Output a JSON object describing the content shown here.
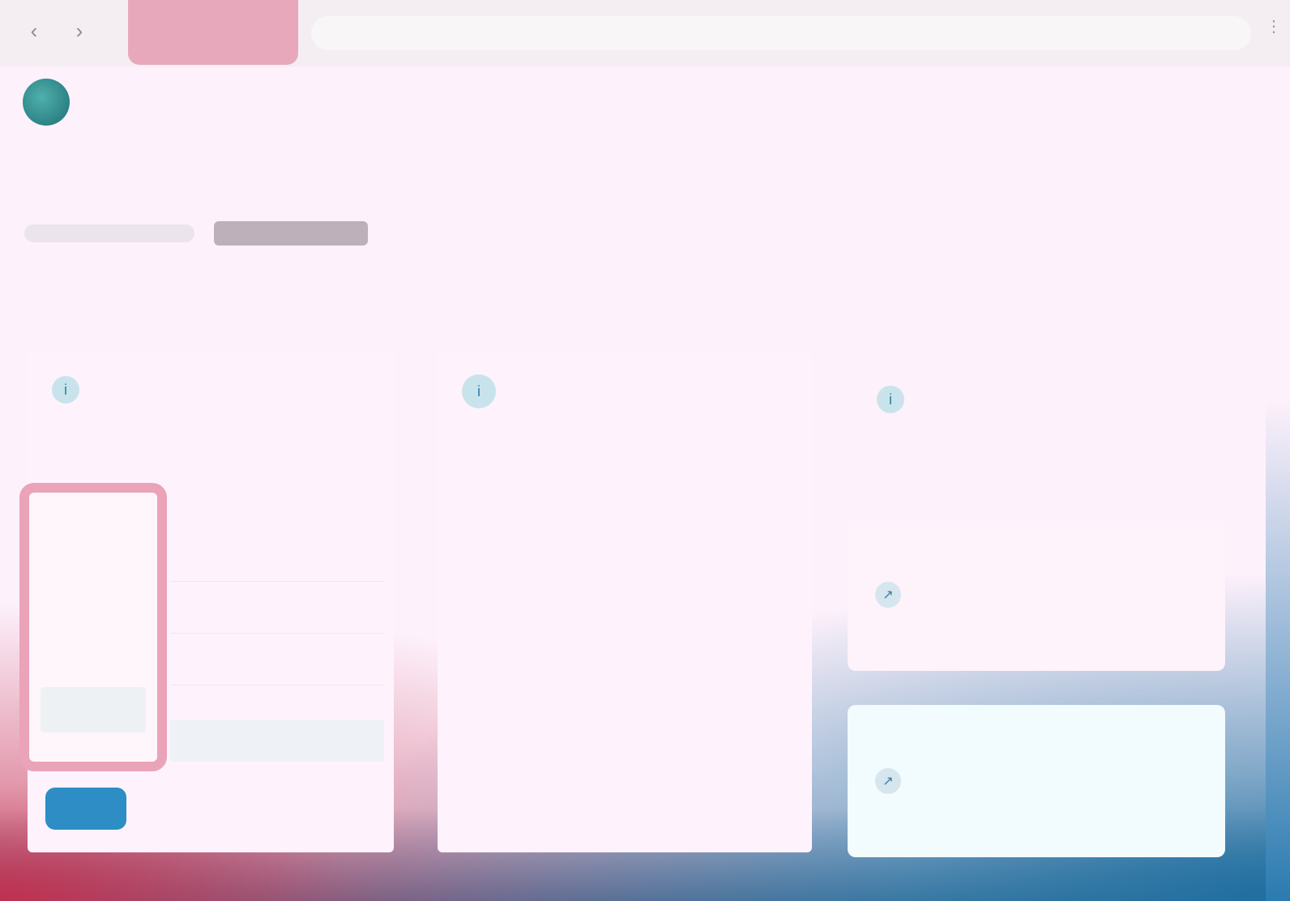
{
  "browser": {
    "back_icon": "chevron-left-icon",
    "forward_icon": "chevron-right-icon",
    "tab_title": "",
    "address": "",
    "menu_icon": "vertical-dots-icon"
  },
  "app": {
    "name": ""
  },
  "breadcrumb": {
    "parent": "",
    "current": ""
  },
  "panels": [
    {
      "title": "",
      "description": "",
      "icon": "info-icon",
      "options": [
        "",
        "",
        "",
        ""
      ],
      "rows": [
        "",
        "",
        "",
        ""
      ],
      "button_label": ""
    },
    {
      "title": "",
      "description": "",
      "icon": "info-icon"
    },
    {
      "title": "",
      "icon": "info-icon",
      "cards": [
        {
          "label": "",
          "icon": "link-icon"
        },
        {
          "label": "",
          "icon": "link-icon"
        }
      ]
    }
  ],
  "colors": {
    "page_background": "#fdf1fb",
    "highlight_pink": "#eaa3b8",
    "primary_blue": "#2d8dc4",
    "logo_teal": "#2a8a8c"
  }
}
